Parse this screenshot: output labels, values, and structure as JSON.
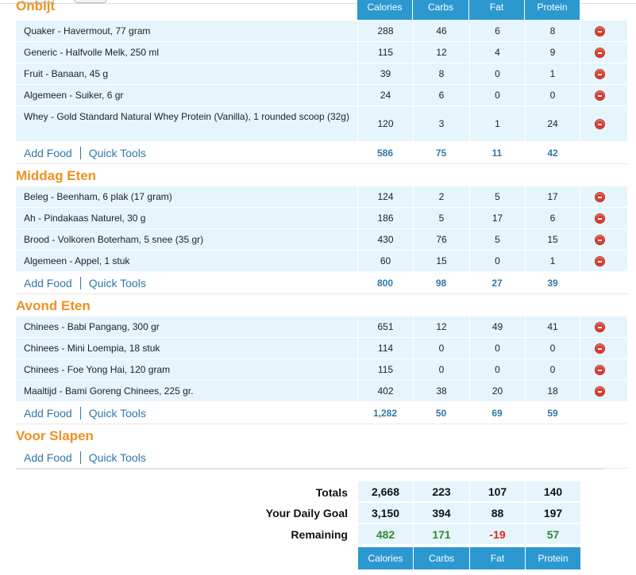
{
  "columns": [
    "Calories",
    "Carbs",
    "Fat",
    "Protein"
  ],
  "meals": [
    {
      "title": "Onbijt",
      "foods": [
        {
          "name": "Quaker - Havermout, 77 gram",
          "cal": "288",
          "carbs": "46",
          "fat": "6",
          "protein": "8"
        },
        {
          "name": "Generic - Halfvolle Melk, 250 ml",
          "cal": "115",
          "carbs": "12",
          "fat": "4",
          "protein": "9"
        },
        {
          "name": "Fruit - Banaan, 45 g",
          "cal": "39",
          "carbs": "8",
          "fat": "0",
          "protein": "1"
        },
        {
          "name": "Algemeen - Suiker, 6 gr",
          "cal": "24",
          "carbs": "6",
          "fat": "0",
          "protein": "0"
        },
        {
          "name": "Whey - Gold Standard Natural Whey Protein (Vanilla), 1 rounded scoop (32g)",
          "cal": "120",
          "carbs": "3",
          "fat": "1",
          "protein": "24"
        }
      ],
      "totals": {
        "cal": "586",
        "carbs": "75",
        "fat": "11",
        "protein": "42"
      }
    },
    {
      "title": "Middag Eten",
      "foods": [
        {
          "name": "Beleg - Beenham, 6 plak (17 gram)",
          "cal": "124",
          "carbs": "2",
          "fat": "5",
          "protein": "17"
        },
        {
          "name": "Ah - Pindakaas Naturel, 30 g",
          "cal": "186",
          "carbs": "5",
          "fat": "17",
          "protein": "6"
        },
        {
          "name": "Brood - Volkoren Boterham, 5 snee (35 gr)",
          "cal": "430",
          "carbs": "76",
          "fat": "5",
          "protein": "15"
        },
        {
          "name": "Algemeen - Appel, 1 stuk",
          "cal": "60",
          "carbs": "15",
          "fat": "0",
          "protein": "1"
        }
      ],
      "totals": {
        "cal": "800",
        "carbs": "98",
        "fat": "27",
        "protein": "39"
      }
    },
    {
      "title": "Avond Eten",
      "foods": [
        {
          "name": "Chinees - Babi Pangang, 300 gr",
          "cal": "651",
          "carbs": "12",
          "fat": "49",
          "protein": "41"
        },
        {
          "name": "Chinees - Mini Loempia, 18 stuk",
          "cal": "114",
          "carbs": "0",
          "fat": "0",
          "protein": "0"
        },
        {
          "name": "Chinees - Foe Yong Hai, 120 gram",
          "cal": "115",
          "carbs": "0",
          "fat": "0",
          "protein": "0"
        },
        {
          "name": "Maaltijd - Bami Goreng Chinees, 225 gr.",
          "cal": "402",
          "carbs": "38",
          "fat": "20",
          "protein": "18"
        }
      ],
      "totals": {
        "cal": "1,282",
        "carbs": "50",
        "fat": "69",
        "protein": "59"
      }
    },
    {
      "title": "Voor Slapen",
      "foods": [],
      "totals": {
        "cal": "",
        "carbs": "",
        "fat": "",
        "protein": ""
      }
    }
  ],
  "actions": {
    "add_food": "Add Food",
    "quick_tools": "Quick Tools"
  },
  "summary": {
    "totals": {
      "label": "Totals",
      "cal": "2,668",
      "carbs": "223",
      "fat": "107",
      "protein": "140"
    },
    "goal": {
      "label": "Your Daily Goal",
      "cal": "3,150",
      "carbs": "394",
      "fat": "88",
      "protein": "197"
    },
    "remaining": {
      "label": "Remaining",
      "cal": "482",
      "carbs": "171",
      "fat": "-19",
      "protein": "57"
    }
  },
  "colors": {
    "accent": "#2b98d0",
    "meal_title": "#ef9122",
    "link": "#2e78a8",
    "row_bg": "#e6f5fc",
    "positive": "#2e8b2e",
    "negative": "#e2231a"
  },
  "icons": {
    "delete": "minus-circle-icon"
  }
}
